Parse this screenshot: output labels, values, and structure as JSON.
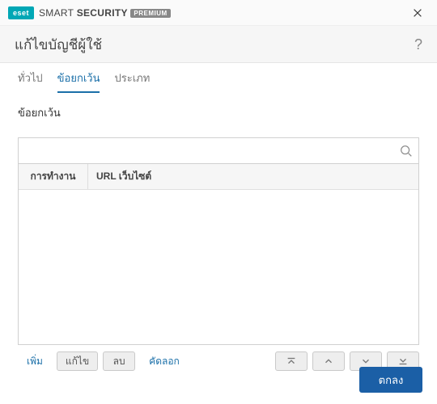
{
  "titlebar": {
    "logo_text": "eset",
    "brand_light": "SMART ",
    "brand_bold": "SECURITY",
    "badge": "PREMIUM"
  },
  "header": {
    "title": "แก้ไขบัญชีผู้ใช้",
    "help": "?"
  },
  "tabs": [
    {
      "label": "ทั่วไป",
      "active": false
    },
    {
      "label": "ข้อยกเว้น",
      "active": true
    },
    {
      "label": "ประเภท",
      "active": false
    }
  ],
  "section_label": "ข้อยกเว้น",
  "search": {
    "value": ""
  },
  "table": {
    "columns": {
      "action": "การทำงาน",
      "url": "URL เว็บไซต์"
    },
    "rows": []
  },
  "buttons": {
    "add": "เพิ่ม",
    "edit": "แก้ไข",
    "delete": "ลบ",
    "copy": "คัดลอก"
  },
  "footer": {
    "ok": "ตกลง"
  }
}
